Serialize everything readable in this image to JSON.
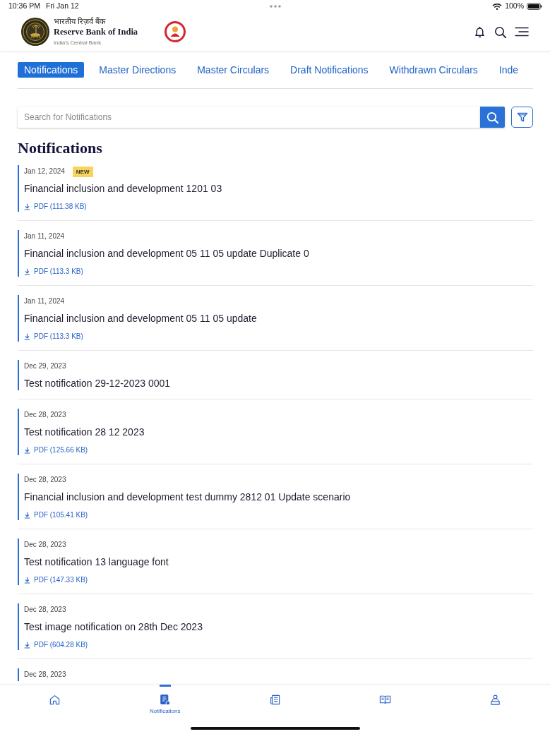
{
  "status_bar": {
    "time": "10:36 PM",
    "date": "Fri Jan 12",
    "battery": "100%"
  },
  "header": {
    "title_hindi": "भारतीय रिज़र्व बैंक",
    "title": "Reserve Bank of India",
    "tagline": "India's Central Bank"
  },
  "tabs": [
    {
      "label": "Notifications",
      "selected": true
    },
    {
      "label": "Master Directions",
      "selected": false
    },
    {
      "label": "Master Circulars",
      "selected": false
    },
    {
      "label": "Draft Notifications",
      "selected": false
    },
    {
      "label": "Withdrawn Circulars",
      "selected": false
    },
    {
      "label": "Inde",
      "selected": false
    }
  ],
  "search": {
    "placeholder": "Search for Notifications"
  },
  "heading": "Notifications",
  "notifications": [
    {
      "date": "Jan 12, 2024",
      "badge": "NEW",
      "title": "Financial inclusion and development 1201 03",
      "attachment": "PDF (111.38 KB)"
    },
    {
      "date": "Jan 11, 2024",
      "title": "Financial inclusion and development 05 11 05 update Duplicate 0",
      "attachment": "PDF (113.3 KB)"
    },
    {
      "date": "Jan 11, 2024",
      "title": "Financial inclusion and development 05 11 05 update",
      "attachment": "PDF (113.3 KB)"
    },
    {
      "date": "Dec 29, 2023",
      "title": "Test notification 29-12-2023 0001"
    },
    {
      "date": "Dec 28, 2023",
      "title": "Test notification 28 12 2023",
      "attachment": "PDF (125.66 KB)"
    },
    {
      "date": "Dec 28, 2023",
      "title": "Financial inclusion and development test dummy 2812 01 Update scenario",
      "attachment": "PDF (105.41 KB)"
    },
    {
      "date": "Dec 28, 2023",
      "title": "Test notification 13 language font",
      "attachment": "PDF (147.33 KB)"
    },
    {
      "date": "Dec 28, 2023",
      "title": "Test image notification on 28th Dec 2023",
      "attachment": "PDF (604.28 KB)"
    },
    {
      "date": "Dec 28, 2023"
    }
  ],
  "bottom_nav": [
    {
      "selected": false
    },
    {
      "label": "Notifications",
      "selected": true
    },
    {
      "selected": false
    },
    {
      "selected": false
    },
    {
      "selected": false
    }
  ]
}
